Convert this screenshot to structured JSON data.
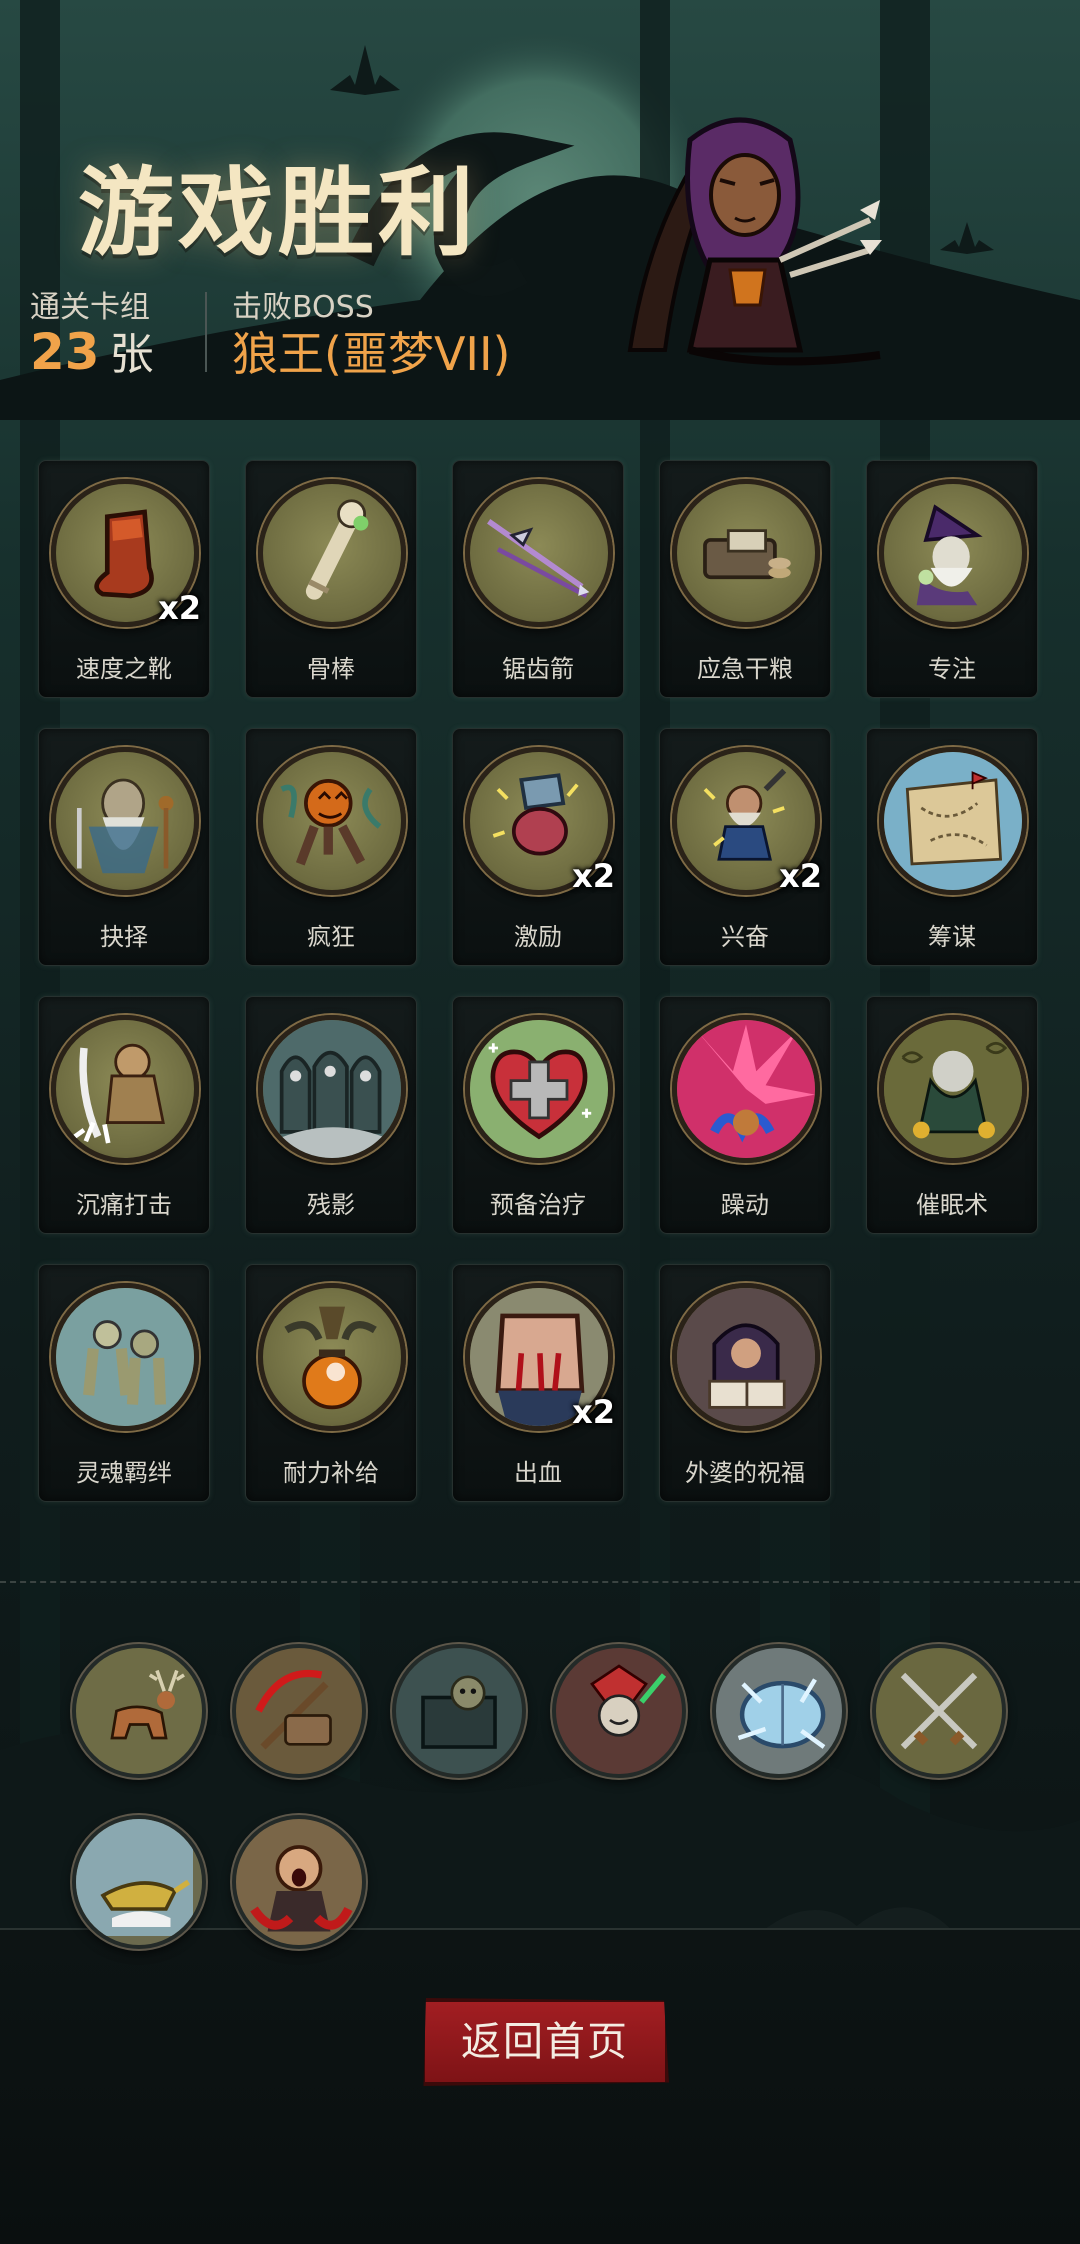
{
  "header": {
    "title": "游戏胜利",
    "cleared_deck_label": "通关卡组",
    "cleared_deck_count": "23",
    "cleared_deck_unit": "张",
    "boss_label": "击败BOSS",
    "boss_name": "狼王(噩梦VII)"
  },
  "cards": [
    {
      "name": "速度之靴",
      "badge": "x2",
      "icon": "boot-icon"
    },
    {
      "name": "骨棒",
      "badge": "",
      "icon": "bone-club-icon"
    },
    {
      "name": "锯齿箭",
      "badge": "",
      "icon": "arrow-icon"
    },
    {
      "name": "应急干粮",
      "badge": "",
      "icon": "rations-icon"
    },
    {
      "name": "专注",
      "badge": "",
      "icon": "wizard-icon"
    },
    {
      "name": "抉择",
      "badge": "",
      "icon": "elder-icon"
    },
    {
      "name": "疯狂",
      "badge": "",
      "icon": "pumpkin-icon"
    },
    {
      "name": "激励",
      "badge": "x2",
      "icon": "warrior-icon"
    },
    {
      "name": "兴奋",
      "badge": "x2",
      "icon": "dwarf-icon"
    },
    {
      "name": "筹谋",
      "badge": "",
      "icon": "map-icon"
    },
    {
      "name": "沉痛打击",
      "badge": "",
      "icon": "brute-icon"
    },
    {
      "name": "残影",
      "badge": "",
      "icon": "hooded-figures-icon"
    },
    {
      "name": "预备治疗",
      "badge": "",
      "icon": "heart-cross-icon"
    },
    {
      "name": "躁动",
      "badge": "",
      "icon": "burst-icon"
    },
    {
      "name": "催眠术",
      "badge": "",
      "icon": "hypnotist-icon"
    },
    {
      "name": "灵魂羁绊",
      "badge": "",
      "icon": "spirits-icon"
    },
    {
      "name": "耐力补给",
      "badge": "",
      "icon": "potion-icon"
    },
    {
      "name": "出血",
      "badge": "x2",
      "icon": "bleeding-fist-icon"
    },
    {
      "name": "外婆的祝福",
      "badge": "",
      "icon": "grandma-icon"
    }
  ],
  "relics": [
    {
      "icon": "deer-icon",
      "bg": "#6e6c46"
    },
    {
      "icon": "scythe-icon",
      "bg": "#6a5a3c"
    },
    {
      "icon": "chest-icon",
      "bg": "#3d5150"
    },
    {
      "icon": "jester-icon",
      "bg": "#5b3a35"
    },
    {
      "icon": "ice-mirror-icon",
      "bg": "#6f7a7a"
    },
    {
      "icon": "crossed-swords-icon",
      "bg": "#6a6840"
    },
    {
      "icon": "lamp-icon",
      "bg": "#6b6a4e"
    },
    {
      "icon": "screaming-man-icon",
      "bg": "#7a6648"
    }
  ],
  "footer": {
    "home_button_label": "返回首页"
  },
  "colors": {
    "accent_orange": "#f0a34a",
    "button_red": "#a21e22",
    "title_cream": "#f4e6c2"
  }
}
